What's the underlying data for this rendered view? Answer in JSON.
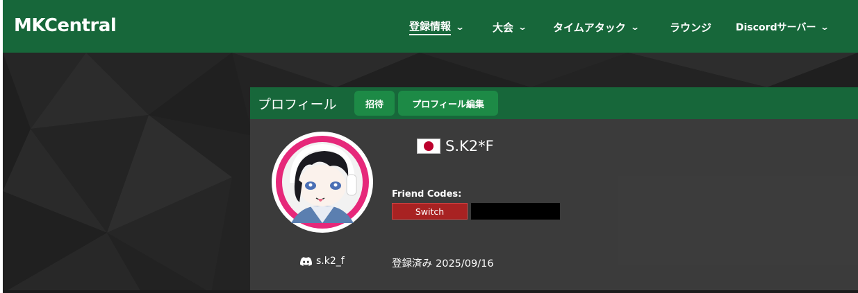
{
  "navbar": {
    "brand": "MKCentral",
    "items": [
      {
        "label": "登録情報",
        "has_dropdown": true,
        "active": true
      },
      {
        "label": "大会",
        "has_dropdown": true
      },
      {
        "label": "タイムアタック",
        "has_dropdown": true
      },
      {
        "label": "ラウンジ",
        "has_dropdown": false
      },
      {
        "label": "Discordサーバー",
        "has_dropdown": true
      }
    ],
    "dropdown_icon": "chevron-down-icon"
  },
  "profile": {
    "title": "プロフィール",
    "invite_label": "招待",
    "edit_label": "プロフィール編集",
    "player_name": "S.K2*F",
    "country_flag": "japan-flag-icon",
    "friend_codes_label": "Friend Codes:",
    "switch_label": "Switch",
    "discord_username": "s.k2_f",
    "registered_label": "登録済み",
    "registered_date": "2025/09/16"
  },
  "colors": {
    "header_green": "#17673a",
    "button_green": "#1d8a46",
    "switch_red": "#a82222",
    "background_dark": "#232323",
    "card_body": "#3e3e3e",
    "avatar_ring": "#e6287a"
  }
}
